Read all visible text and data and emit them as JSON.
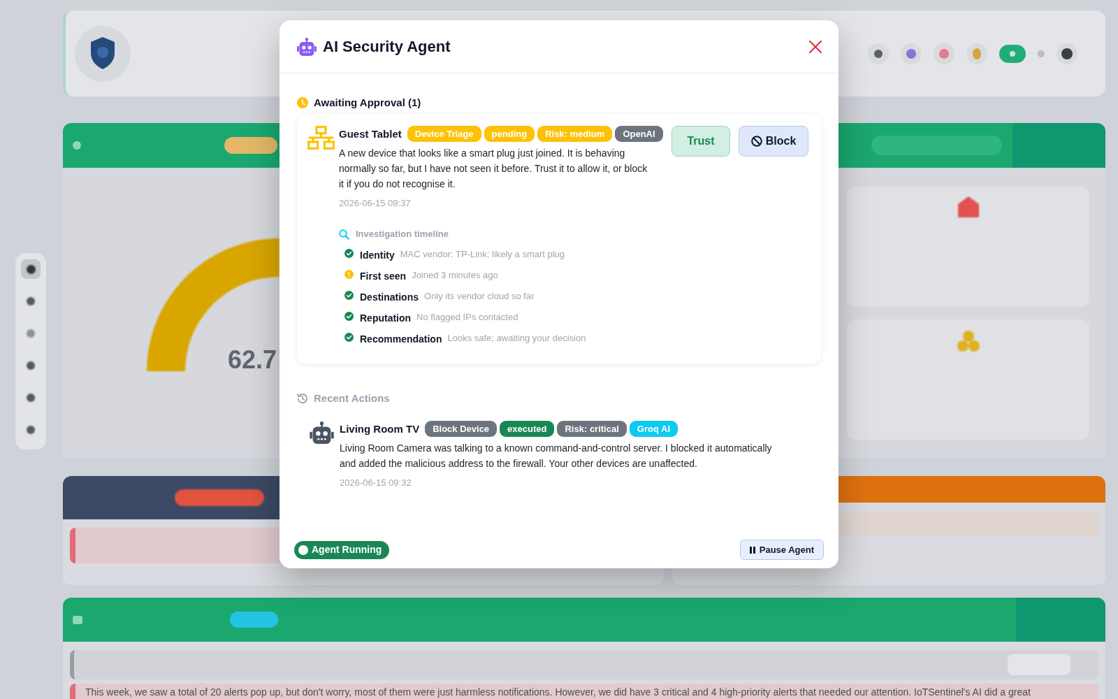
{
  "dashboard": {
    "gauge_value": "62.7",
    "summary": "This week, we saw a total of 20 alerts pop up, but don't worry, most of them were just harmless notifications. However, we did have 3 critical and 4 high-priority alerts that needed our attention. IoTSentinel's AI did a great"
  },
  "dialog": {
    "title": "AI Security Agent",
    "approval": {
      "heading": "Awaiting Approval (1)",
      "items": [
        {
          "device": "Guest Tablet",
          "badges": [
            {
              "label": "Device Triage",
              "color": "#ffc107"
            },
            {
              "label": "pending",
              "color": "#ffc107"
            },
            {
              "label": "Risk: medium",
              "color": "#ffc107"
            },
            {
              "label": "OpenAI",
              "color": "#6c757d"
            }
          ],
          "message": "A new device that looks like a smart plug just joined. It is behaving normally so far, but I have not seen it before. Trust it to allow it, or block it if you do not recognise it.",
          "time": "2026-06-15 09:37",
          "buttons": [
            {
              "kind": "trust",
              "label": "Trust"
            },
            {
              "kind": "block",
              "label": "Block"
            }
          ],
          "timeline": {
            "heading": "Investigation timeline",
            "steps": [
              {
                "kind": "check",
                "label": "Identity",
                "detail": "MAC vendor: TP-Link; likely a smart plug"
              },
              {
                "kind": "warning",
                "label": "First seen",
                "detail": "Joined 3 minutes ago"
              },
              {
                "kind": "check",
                "label": "Destinations",
                "detail": "Only its vendor cloud so far"
              },
              {
                "kind": "check",
                "label": "Reputation",
                "detail": "No flagged IPs contacted"
              },
              {
                "kind": "check",
                "label": "Recommendation",
                "detail": "Looks safe; awaiting your decision"
              }
            ]
          }
        }
      ]
    },
    "recent": {
      "heading": "Recent Actions",
      "items": [
        {
          "device": "Living Room TV",
          "badges": [
            {
              "label": "Block Device",
              "color": "#6c757d"
            },
            {
              "label": "executed",
              "color": "#198754"
            },
            {
              "label": "Risk: critical",
              "color": "#6c757d"
            },
            {
              "label": "Groq AI",
              "color": "#0dcaf0"
            }
          ],
          "message": "Living Room Camera was talking to a known command-and-control server. I blocked it automatically and added the malicious address to the firewall. Your other devices are unaffected.",
          "time": "2026-06-15 09:32"
        }
      ]
    },
    "footer": {
      "status": "Agent Running",
      "button": "Pause Agent"
    }
  }
}
